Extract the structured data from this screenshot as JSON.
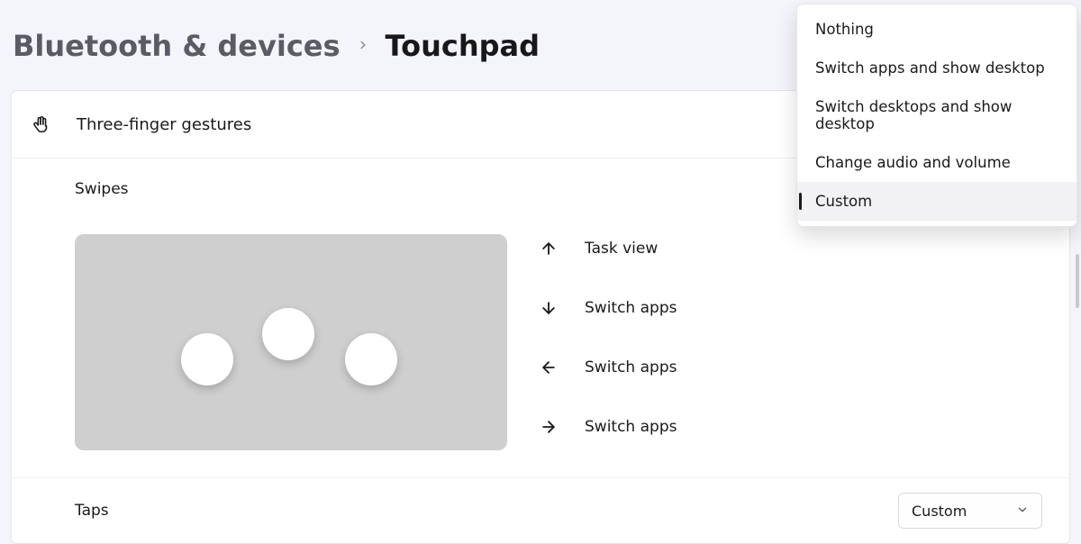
{
  "breadcrumb": {
    "parent": "Bluetooth & devices",
    "current": "Touchpad"
  },
  "section": {
    "title": "Three-finger gestures"
  },
  "swipes": {
    "label": "Swipes",
    "directions": [
      {
        "icon": "arrow-up",
        "label": "Task view"
      },
      {
        "icon": "arrow-down",
        "label": "Switch apps"
      },
      {
        "icon": "arrow-left",
        "label": "Switch apps"
      },
      {
        "icon": "arrow-right",
        "label": "Switch apps"
      }
    ]
  },
  "taps": {
    "label": "Taps",
    "combo_value": "Custom"
  },
  "dropdown": {
    "options": [
      "Nothing",
      "Switch apps and show desktop",
      "Switch desktops and show desktop",
      "Change audio and volume",
      "Custom"
    ],
    "selected": "Custom"
  }
}
